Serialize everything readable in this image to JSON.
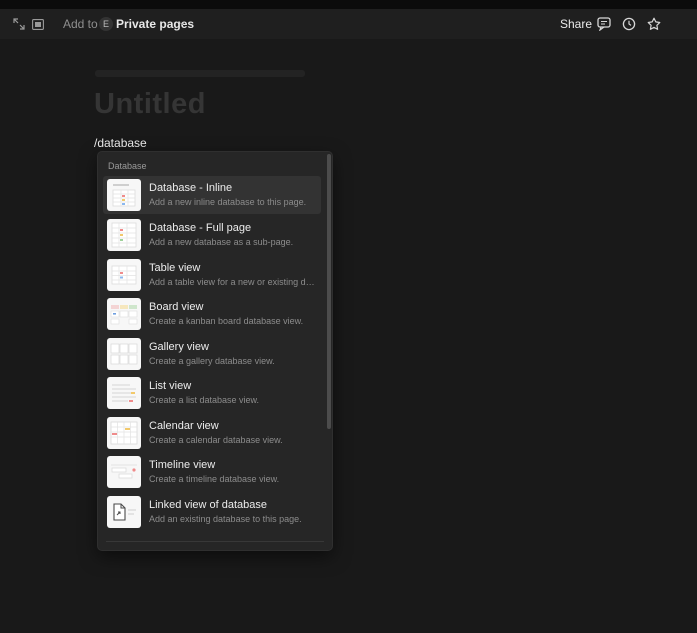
{
  "topbar": {
    "add_to": "Add to",
    "workspace_initial": "E",
    "page_location": "Private pages",
    "share_label": "Share",
    "icons": [
      "expand-icon",
      "sidebar-peek-icon",
      "chevron-down-icon",
      "comment-icon",
      "clock-icon",
      "star-icon"
    ]
  },
  "page": {
    "title_placeholder": "Untitled",
    "command_text": "/database"
  },
  "menu": {
    "section_label": "Database",
    "items": [
      {
        "title": "Database - Inline",
        "desc": "Add a new inline database to this page.",
        "icon": "inline-database-thumb"
      },
      {
        "title": "Database - Full page",
        "desc": "Add a new database as a sub-page.",
        "icon": "fullpage-database-thumb"
      },
      {
        "title": "Table view",
        "desc": "Add a table view for a new or existing dat...",
        "icon": "table-view-thumb"
      },
      {
        "title": "Board view",
        "desc": "Create a kanban board database view.",
        "icon": "board-view-thumb"
      },
      {
        "title": "Gallery view",
        "desc": "Create a gallery database view.",
        "icon": "gallery-view-thumb"
      },
      {
        "title": "List view",
        "desc": "Create a list database view.",
        "icon": "list-view-thumb"
      },
      {
        "title": "Calendar view",
        "desc": "Create a calendar database view.",
        "icon": "calendar-view-thumb"
      },
      {
        "title": "Timeline view",
        "desc": "Create a timeline database view.",
        "icon": "timeline-view-thumb"
      },
      {
        "title": "Linked view of database",
        "desc": "Add an existing database to this page.",
        "icon": "linked-database-thumb"
      }
    ]
  }
}
